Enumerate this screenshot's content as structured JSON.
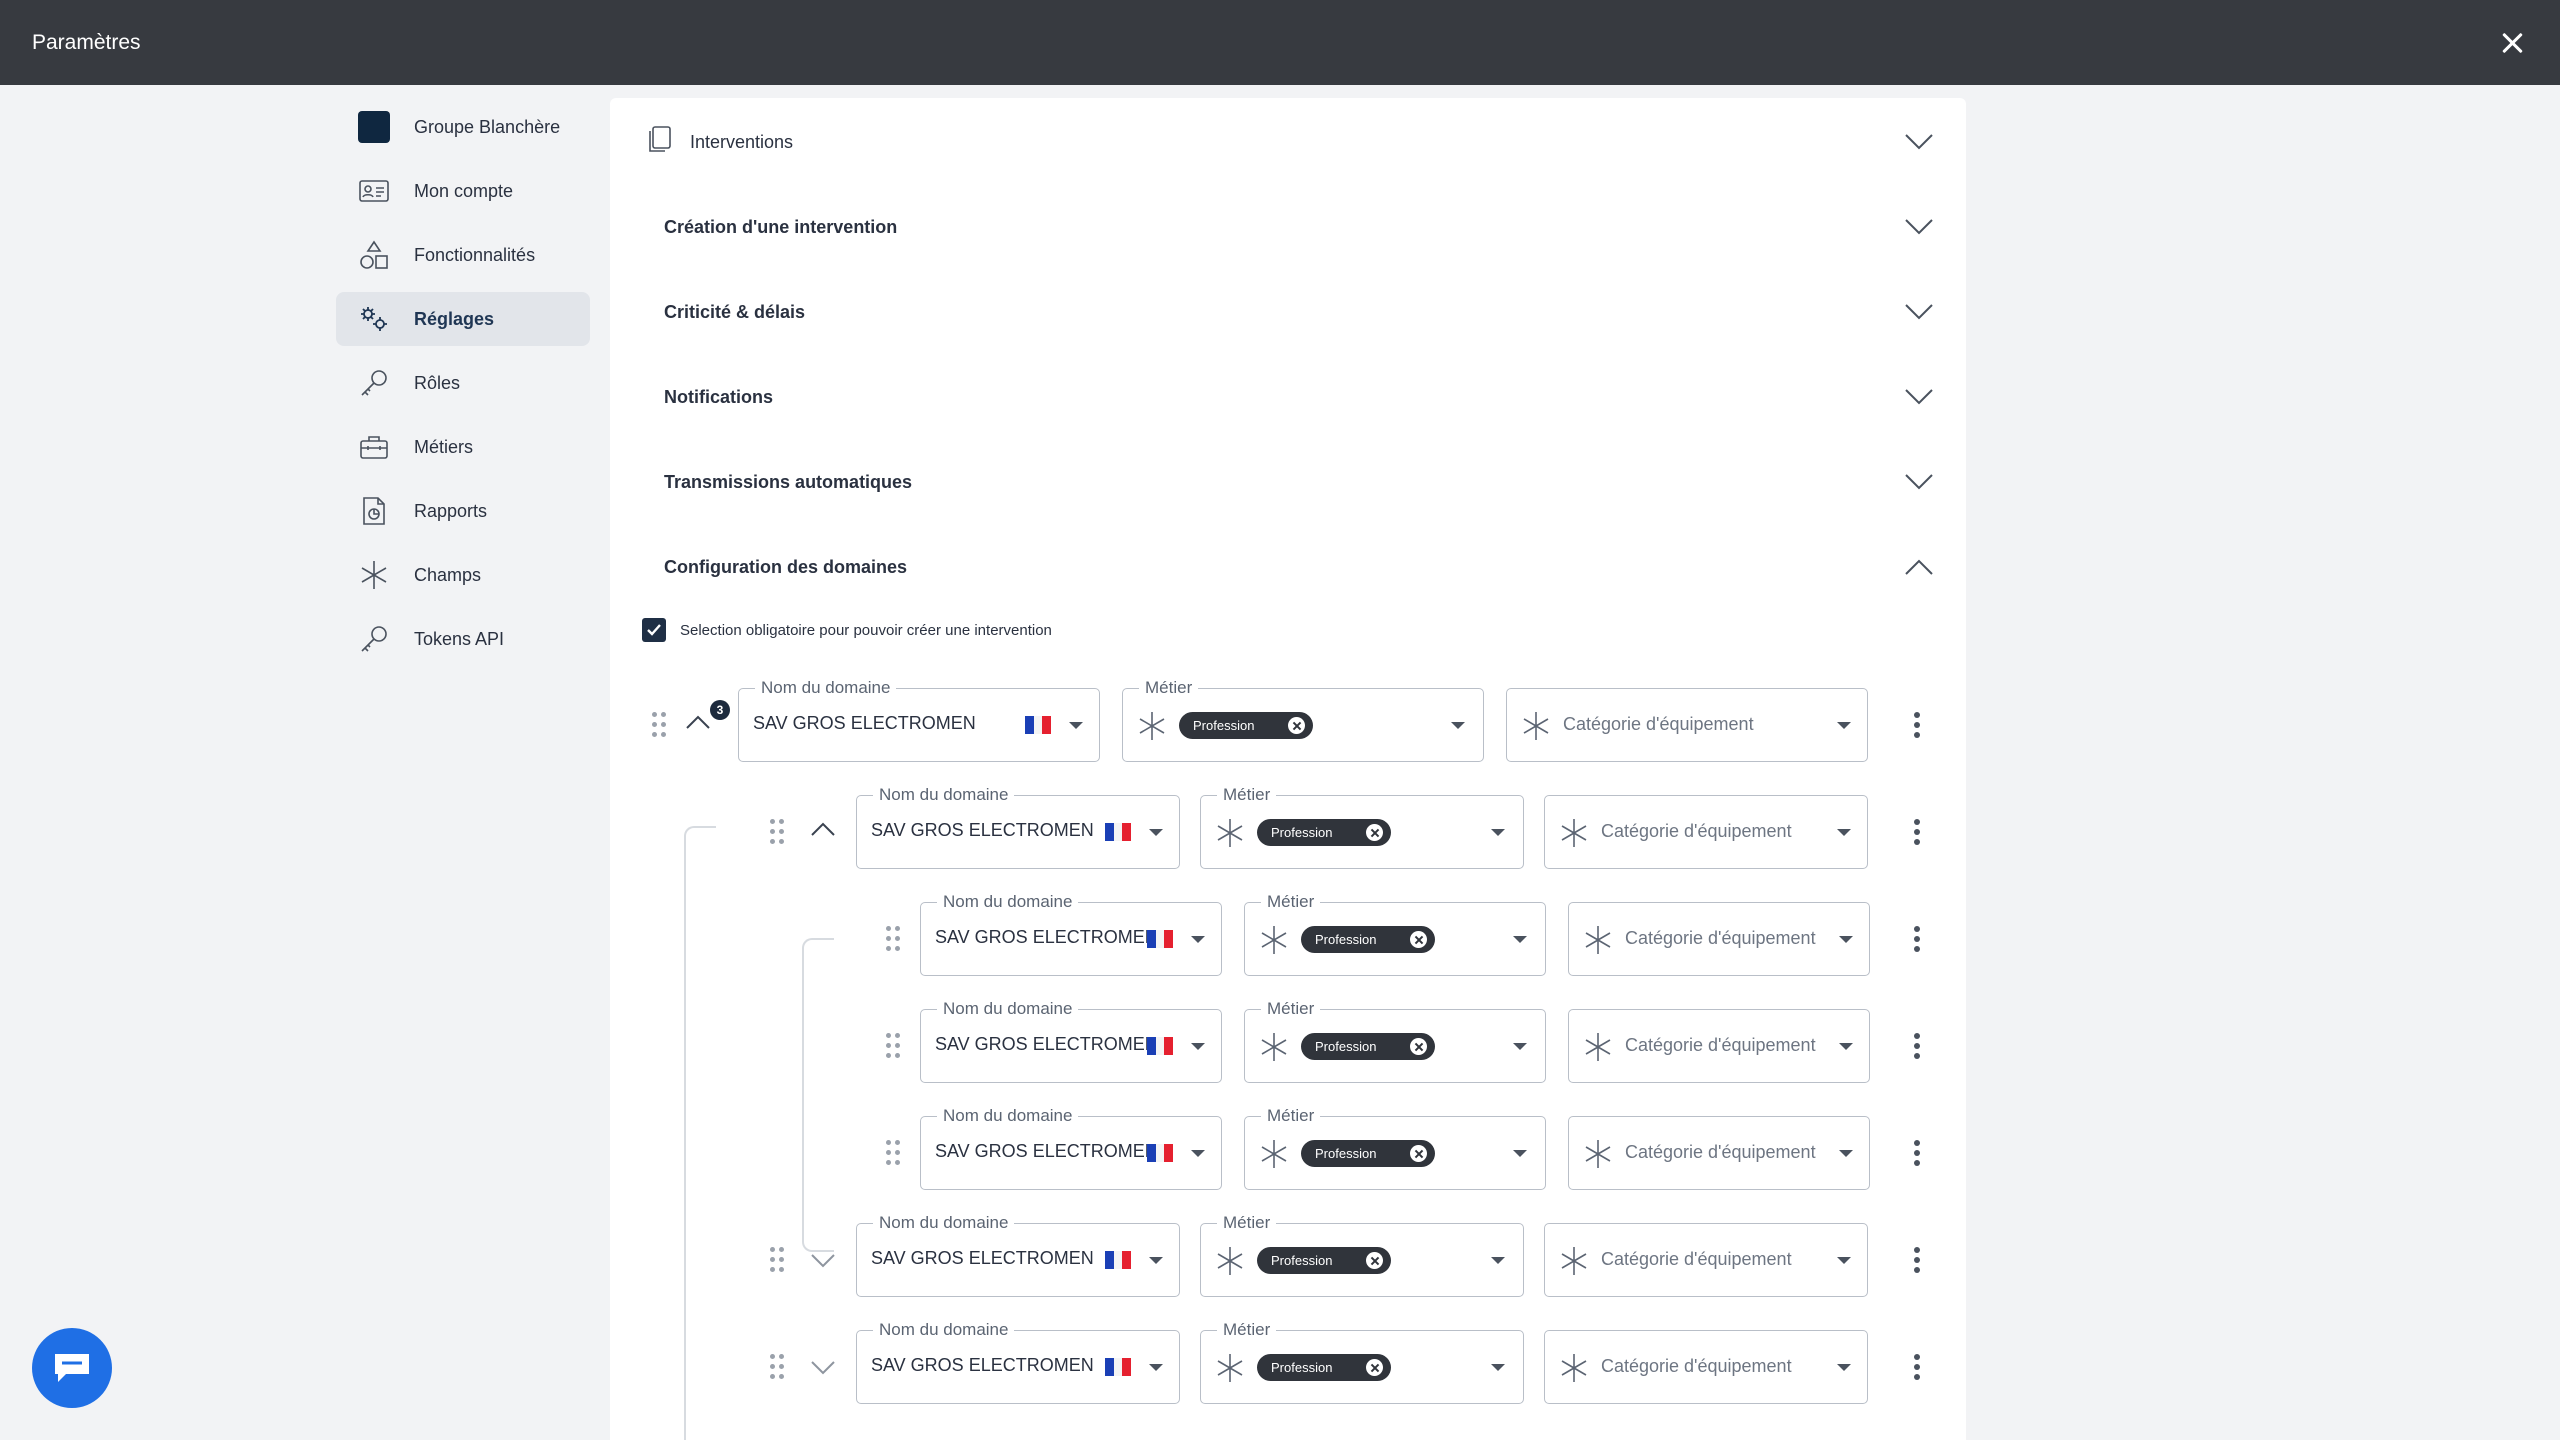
{
  "window": {
    "title": "Paramètres"
  },
  "sidebar": {
    "items": [
      {
        "label": "Groupe Blanchère",
        "icon": "org-logo"
      },
      {
        "label": "Mon compte",
        "icon": "id-card-icon"
      },
      {
        "label": "Fonctionnalités",
        "icon": "shapes-icon"
      },
      {
        "label": "Réglages",
        "icon": "settings-gears-icon",
        "active": true
      },
      {
        "label": "Rôles",
        "icon": "key-icon"
      },
      {
        "label": "Métiers",
        "icon": "toolbox-icon"
      },
      {
        "label": "Rapports",
        "icon": "report-icon"
      },
      {
        "label": "Champs",
        "icon": "asterisk-icon"
      },
      {
        "label": "Tokens API",
        "icon": "key-icon"
      }
    ]
  },
  "panel": {
    "title": "Interventions",
    "sections": [
      {
        "label": "Création d'une intervention",
        "expanded": false
      },
      {
        "label": "Criticité & délais",
        "expanded": false
      },
      {
        "label": "Notifications",
        "expanded": false
      },
      {
        "label": "Transmissions automatiques",
        "expanded": false
      },
      {
        "label": "Configuration des domaines",
        "expanded": true
      }
    ],
    "checkbox": {
      "label": "Selection obligatoire pour pouvoir créer une intervention",
      "checked": true
    },
    "domain_legend": "Nom du domaine",
    "metier_legend": "Métier",
    "domain_value": "SAV GROS ELECTROMEN",
    "chip_label": "Profession",
    "category_placeholder": "Catégorie d'équipement",
    "children_badge": "3"
  },
  "colors": {
    "topbar": "#373a40",
    "accent": "#1f6fe5",
    "chip": "#30343b"
  }
}
